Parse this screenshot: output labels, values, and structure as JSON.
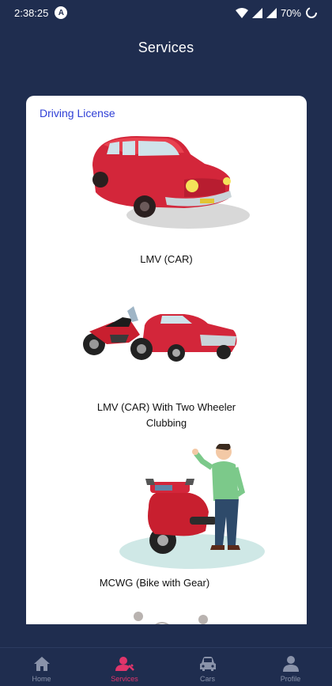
{
  "status_bar": {
    "time": "2:38:25",
    "notification_letter": "A",
    "battery": "70%"
  },
  "header": {
    "title": "Services"
  },
  "section": {
    "title": "Driving License"
  },
  "services": [
    {
      "label": "LMV (CAR)",
      "illustration": "red-vintage-car-icon"
    },
    {
      "label_line1": "LMV (CAR) With Two Wheeler",
      "label_line2": "Clubbing",
      "illustration": "motorbike-and-car-icon"
    },
    {
      "label": "MCWG (Bike with Gear)",
      "illustration": "man-with-motorbike-icon"
    }
  ],
  "bottom_nav": [
    {
      "label": "Home",
      "icon": "home-icon",
      "active": false
    },
    {
      "label": "Services",
      "icon": "services-icon",
      "active": true
    },
    {
      "label": "Cars",
      "icon": "car-icon",
      "active": false
    },
    {
      "label": "Profile",
      "icon": "profile-icon",
      "active": false
    }
  ],
  "colors": {
    "background": "#1f2d4f",
    "accent": "#e0356b",
    "section_title": "#2f3fd6"
  }
}
